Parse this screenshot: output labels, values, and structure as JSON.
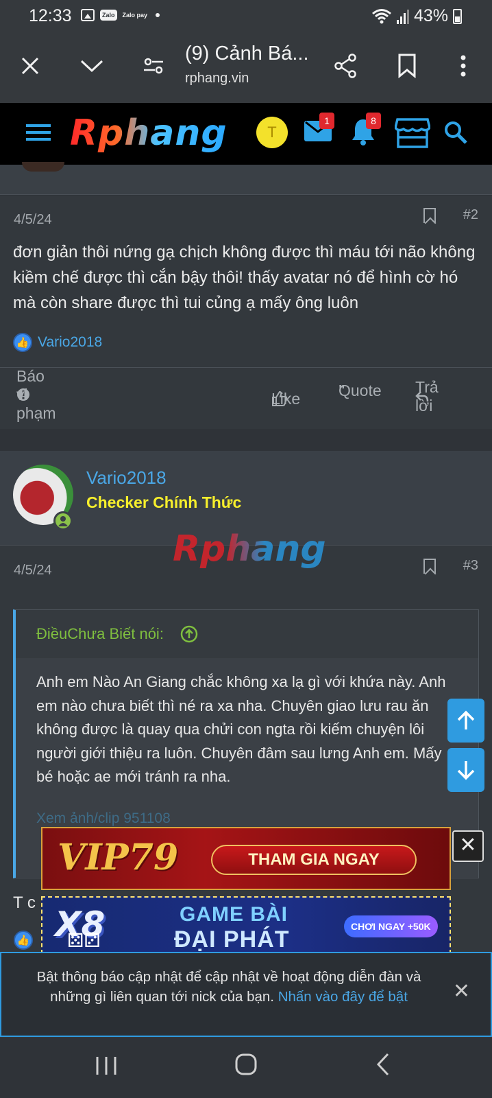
{
  "status_bar": {
    "time": "12:33",
    "zalo_label": "Zalo",
    "zalopay_label": "Zalo pay",
    "battery": "43%"
  },
  "browser": {
    "tab_title": "(9) Cảnh Bá...",
    "url": "rphang.vin"
  },
  "site_header": {
    "logo_text": "Rphang",
    "avatar_initial": "T",
    "messages_badge": "1",
    "alerts_badge": "8"
  },
  "post2": {
    "date": "4/5/24",
    "number": "#2",
    "body": "đơn giản thôi nứng gạ chịch không được thì máu tới não không kiềm chế được thì cắn bậy thôi! thấy avatar nó để hình cờ hó mà còn share được thì tui củng ạ mấy ông luôn",
    "reaction_user": "Vario2018",
    "report_label": "Báo vi phạm",
    "like_label": "Like",
    "quote_label": "Quote",
    "reply_label": "Trả lời"
  },
  "post3": {
    "author": "Vario2018",
    "author_title": "Checker Chính Thức",
    "watermark": "Rphang",
    "date": "4/5/24",
    "number": "#3",
    "quote_author": "ĐiềuChưa Biết nói:",
    "quote_text": "Anh em Nào An Giang chắc không xa lạ gì với khứa này. Anh em nào chưa biết thì né ra xa nha. Chuyên giao lưu rau ăn không được là quay qua chửi con ngta rồi kiếm chuyện lôi người giới thiệu ra luôn. Chuyên đâm sau lưng Anh em. Mấy bé hoặc ae mới tránh ra nha.",
    "quote_more": "Xem ảnh/clip 951108",
    "partial_text": "T c"
  },
  "ads": {
    "banner1_brand": "VIP79",
    "banner1_cta": "THAM GIA NGAY",
    "banner2_brand": "X8",
    "banner2_line1": "GAME BÀI",
    "banner2_line2": "ĐẠI PHÁT",
    "banner2_cta": "CHƠI NGAY +50K"
  },
  "notification": {
    "text": "Bật thông báo cập nhật để cập nhật về hoạt động diễn đàn và những gì liên quan tới nick của bạn.",
    "link": "Nhấn vào đây để bật"
  },
  "colors": {
    "link_blue": "#4aa7e6",
    "title_yellow": "#f7ef2c",
    "quote_green": "#7fbf3f",
    "scroll_button": "#2f9be0"
  }
}
